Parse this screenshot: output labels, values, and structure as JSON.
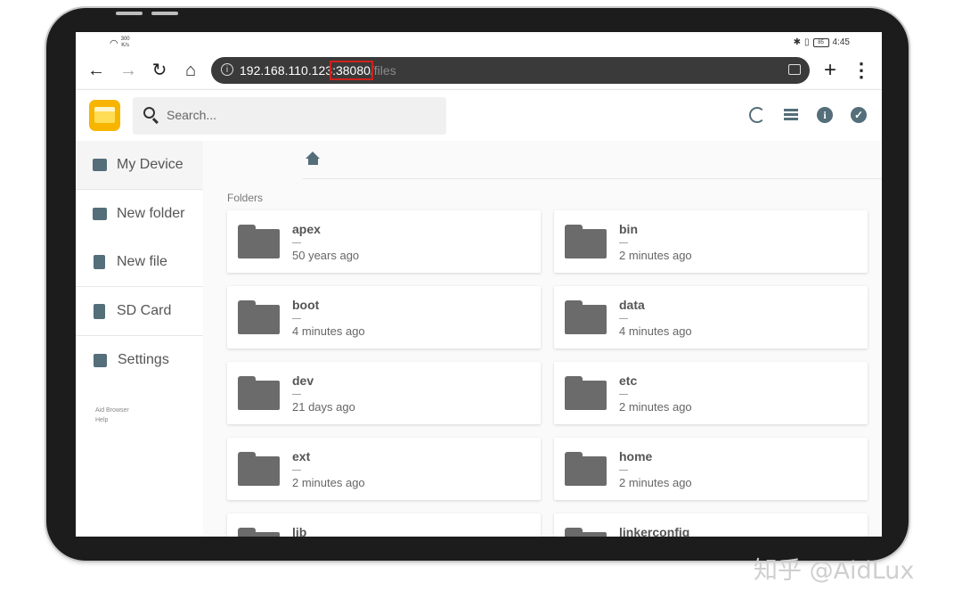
{
  "status_bar": {
    "network_speed": "300",
    "speed_unit": "K/s",
    "icons": [
      "wifi-icon",
      "bluetooth-icon",
      "vibrate-icon",
      "battery-icon"
    ],
    "battery": "85",
    "time": "4:45"
  },
  "browser": {
    "url_host": "192.168.110.123",
    "url_port": ":38080",
    "url_path": "/files",
    "nav_icons": {
      "back": "←",
      "forward": "→",
      "reload": "↻",
      "home": "⌂",
      "new_tab": "+",
      "menu": "⋮"
    }
  },
  "header": {
    "search_placeholder": "Search...",
    "actions": [
      "refresh-icon",
      "list-view-icon",
      "info-icon",
      "select-icon"
    ]
  },
  "sidebar": {
    "items": [
      {
        "label": "My Device",
        "icon": "folder-icon"
      },
      {
        "label": "New folder",
        "icon": "add-folder-icon"
      },
      {
        "label": "New file",
        "icon": "add-file-icon"
      },
      {
        "label": "SD Card",
        "icon": "sd-card-icon"
      },
      {
        "label": "Settings",
        "icon": "settings-icon"
      }
    ],
    "footer": [
      "Aid Browser",
      "Help"
    ]
  },
  "main": {
    "section_label": "Folders",
    "folders": [
      {
        "name": "apex",
        "size": "—",
        "modified": "50 years ago"
      },
      {
        "name": "bin",
        "size": "—",
        "modified": "2 minutes ago"
      },
      {
        "name": "boot",
        "size": "—",
        "modified": "4 minutes ago"
      },
      {
        "name": "data",
        "size": "—",
        "modified": "4 minutes ago"
      },
      {
        "name": "dev",
        "size": "—",
        "modified": "21 days ago"
      },
      {
        "name": "etc",
        "size": "—",
        "modified": "2 minutes ago"
      },
      {
        "name": "ext",
        "size": "—",
        "modified": "2 minutes ago"
      },
      {
        "name": "home",
        "size": "—",
        "modified": "2 minutes ago"
      },
      {
        "name": "lib",
        "size": "",
        "modified": ""
      },
      {
        "name": "linkerconfig",
        "size": "",
        "modified": ""
      }
    ]
  },
  "watermark": "知乎 @AidLux",
  "colors": {
    "accent": "#546e7a",
    "highlight": "#d0211c",
    "logo": "#f7b500"
  }
}
